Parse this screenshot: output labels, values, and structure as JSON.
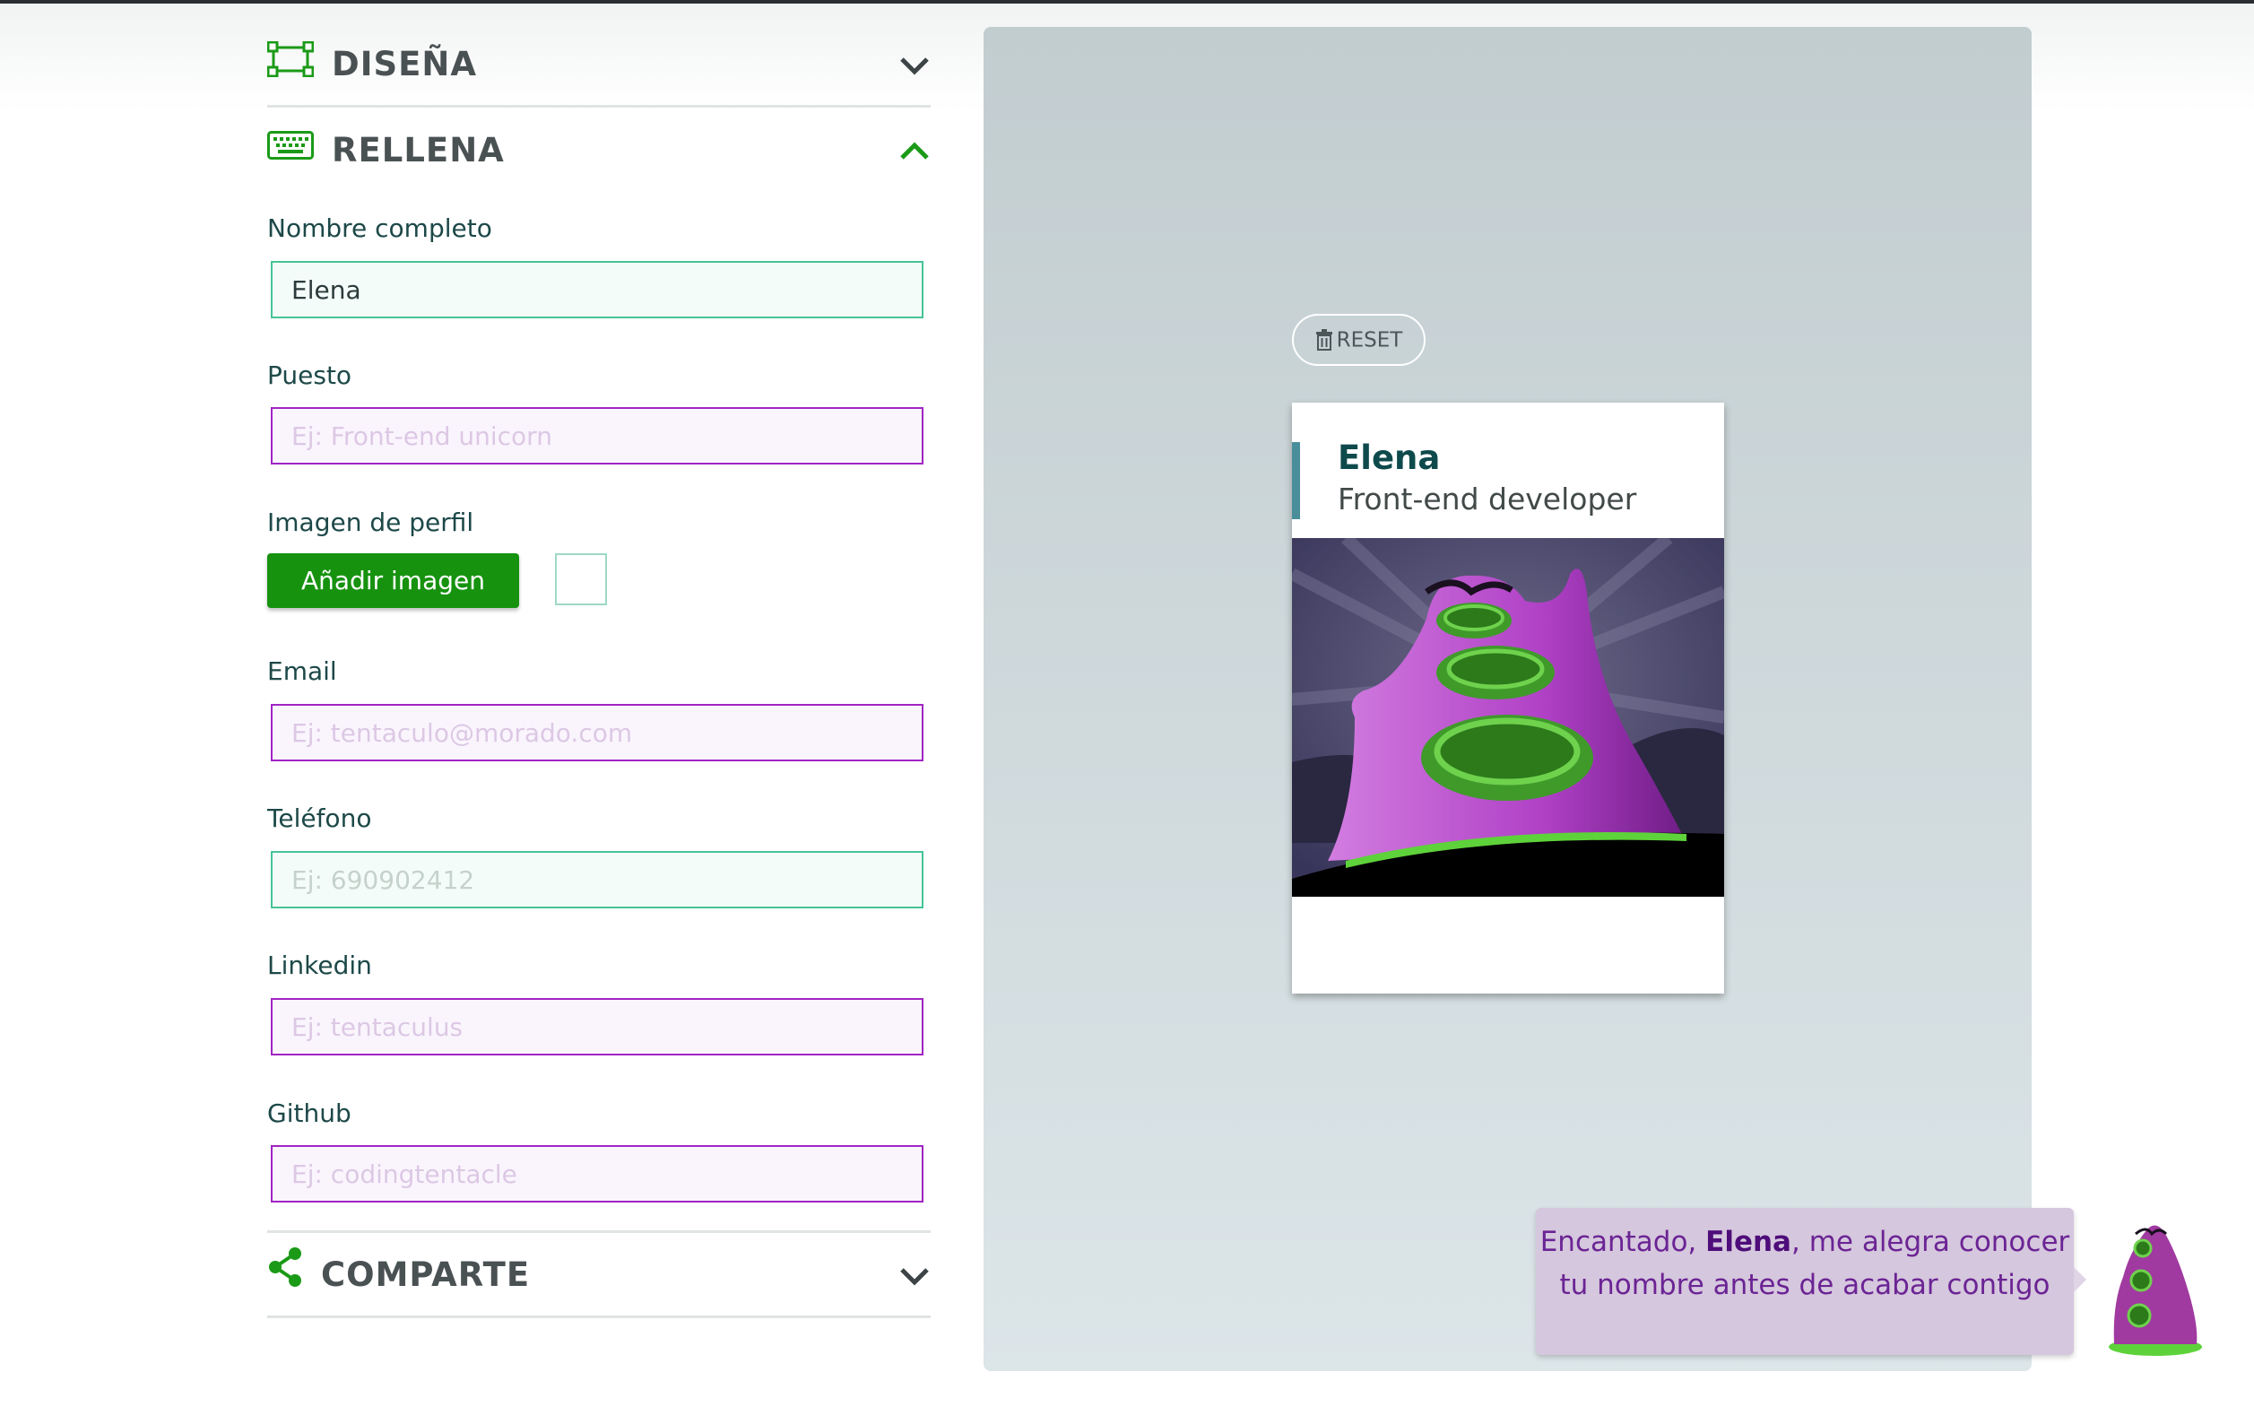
{
  "sections": {
    "design": {
      "title": "DISEÑA",
      "icon": "layout-frame-icon",
      "state": "collapsed"
    },
    "fill": {
      "title": "RELLENA",
      "icon": "keyboard-icon",
      "state": "expanded"
    },
    "share": {
      "title": "COMPARTE",
      "icon": "share-icon",
      "state": "collapsed"
    }
  },
  "form": {
    "name": {
      "label": "Nombre completo",
      "value": "Elena",
      "placeholder": ""
    },
    "job": {
      "label": "Puesto",
      "value": "",
      "placeholder": "Ej: Front-end unicorn"
    },
    "image": {
      "label": "Imagen de perfil",
      "button": "Añadir imagen"
    },
    "email": {
      "label": "Email",
      "value": "",
      "placeholder": "Ej: tentaculo@morado.com"
    },
    "phone": {
      "label": "Teléfono",
      "value": "",
      "placeholder": "Ej: 690902412"
    },
    "linkedin": {
      "label": "Linkedin",
      "value": "",
      "placeholder": "Ej: tentaculus"
    },
    "github": {
      "label": "Github",
      "value": "",
      "placeholder": "Ej: codingtentacle"
    }
  },
  "preview": {
    "reset": "RESET",
    "card": {
      "name": "Elena",
      "job": "Front-end developer"
    }
  },
  "bubble": {
    "before": "Encantado, ",
    "name": "Elena",
    "after": ", me alegra conocer tu nombre antes de acabar contigo"
  },
  "colors": {
    "accent_green": "#16920f",
    "field_green_border": "#46c496",
    "field_purple_border": "#a124c4",
    "card_name": "#0e4a4c",
    "bubble_text": "#6b2494"
  }
}
